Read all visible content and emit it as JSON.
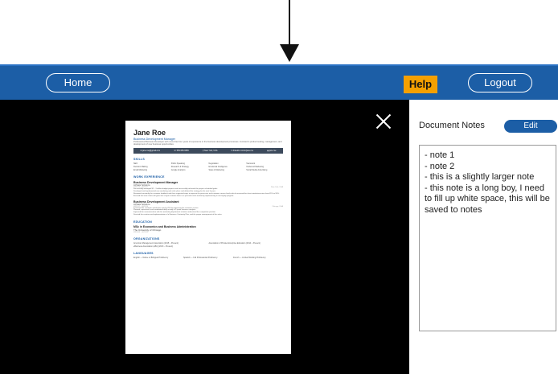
{
  "header": {
    "home_label": "Home",
    "help_label": "Help",
    "logout_label": "Logout"
  },
  "colors": {
    "header_bg": "#1c5ea6",
    "help_bg": "#f5a000",
    "viewer_bg": "#000000"
  },
  "viewer": {
    "close_icon": "close-icon",
    "resume": {
      "name": "Jane Roe",
      "title": "Business Development Manager",
      "summary": "Professional Business Developer with more than four years of experience in the business development processes. Involved in product testing, management, and development of new business opportunities.",
      "contact": [
        "✉ jane.roe@gmail.com",
        "☏ 555-555-5555",
        "⚲ New York, USA",
        "in linkedin.com/in/jane.roe",
        "◉ jane.roe"
      ],
      "sections": {
        "skills": "SKILLS",
        "work": "WORK EXPERIENCE",
        "education": "EDUCATION",
        "organizations": "ORGANIZATIONS",
        "languages": "LANGUAGES"
      },
      "skills": [
        "SEO",
        "Public Speaking",
        "Negotiation",
        "Teamwork",
        "Decision Making",
        "Research & Strategy",
        "Emotional Intelligence",
        "Outbound Marketing",
        "Email Marketing",
        "Google Analytics",
        "Sales & Marketing",
        "Social Media Advertising"
      ],
      "jobs": [
        {
          "title": "Business Development Manager",
          "company": "AirState Solutions",
          "dates": "09/2014 – 06/2017",
          "location": "New York, USA",
          "bullets": [
            "Successfully managed $2 – 3 million budget projects and successfully achieved the project scheduled goals.",
            "Developed and implemented new marketing and sales plans and defined the strategy for the next 5 years.",
            "Reviewed constantly the customer feedback and then suggested ways to improve the processes and customer service levels which increased the client satisfaction rates from 81% to 95%.",
            "Ensured that new clients will grow into a loyal customer base in a specialist niche market by implementing a new loyalty program."
          ]
        },
        {
          "title": "Business Development Assistant",
          "company": "AirState Solutions",
          "dates": "08/2012 – 09/2014",
          "location": "Chicago, USA",
          "bullets": [
            "Increased the customer satisfaction rate by 25% by improving the customer service.",
            "Planned, supervised, and coordinated daily activity of 3 junior business analysts.",
            "Improved the communication with the marketing department to better understand the competitive position.",
            "Directed the creation and implementation of a Business Continuity Plan, and the proper management of the sales."
          ]
        }
      ],
      "education": {
        "degree": "MSc in Economics and Business Administration",
        "school": "The University of Chicago",
        "dates": "09/2008 – 06/2010"
      },
      "organizations": [
        "American Management Association (2015 – Present)",
        "Association of Private Enterprise Education (2014 – Present)",
        "eBusiness Association (eBA) (2013 – Present)"
      ],
      "languages": [
        "English — Native or Bilingual Proficiency",
        "Spanish — Full Professional Proficiency",
        "French — Limited Working Proficiency"
      ]
    }
  },
  "notes_panel": {
    "title": "Document Notes",
    "edit_label": "Edit",
    "notes": [
      "- note 1",
      "- note 2",
      "- this is a slightly larger note",
      "- this note is a long boy, I need to fill up white space, this will be saved to notes"
    ]
  }
}
